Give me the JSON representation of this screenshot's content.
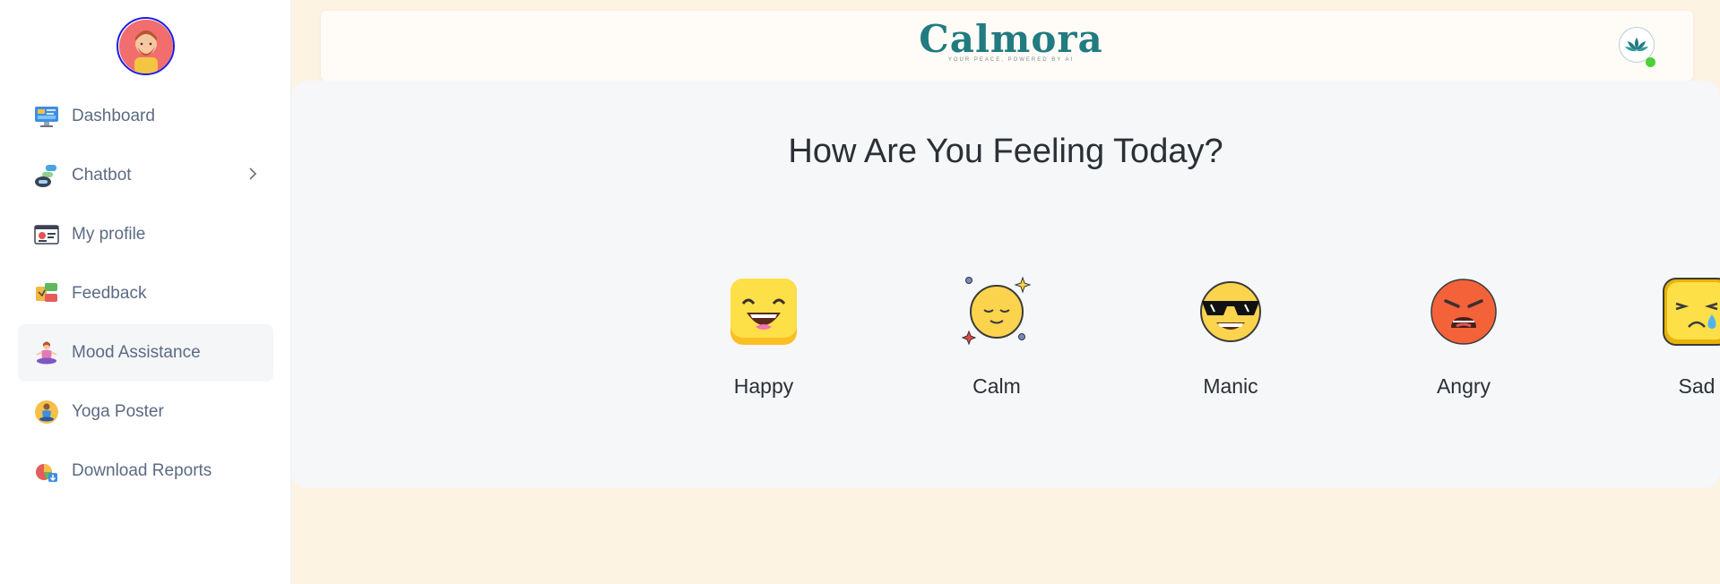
{
  "sidebar": {
    "items": [
      {
        "label": "Dashboard",
        "icon": "dashboard-monitor-icon"
      },
      {
        "label": "Chatbot",
        "icon": "chatbot-icon",
        "has_submenu": true
      },
      {
        "label": "My profile",
        "icon": "profile-card-icon"
      },
      {
        "label": "Feedback",
        "icon": "feedback-icon"
      },
      {
        "label": "Mood Assistance",
        "icon": "meditation-icon",
        "active": true
      },
      {
        "label": "Yoga Poster",
        "icon": "yoga-icon"
      },
      {
        "label": "Download Reports",
        "icon": "reports-chart-icon"
      }
    ]
  },
  "header": {
    "brand": "Calmora",
    "tagline": "YOUR PEACE, POWERED BY AI"
  },
  "main": {
    "title": "How Are You Feeling Today?",
    "moods": [
      {
        "label": "Happy",
        "icon": "happy-emoji-icon"
      },
      {
        "label": "Calm",
        "icon": "calm-emoji-icon"
      },
      {
        "label": "Manic",
        "icon": "manic-sunglasses-emoji-icon"
      },
      {
        "label": "Angry",
        "icon": "angry-emoji-icon"
      },
      {
        "label": "Sad",
        "icon": "sad-emoji-icon"
      }
    ]
  },
  "colors": {
    "brand": "#217b80",
    "page_bg": "#fdf3e3",
    "online": "#4cd137"
  }
}
